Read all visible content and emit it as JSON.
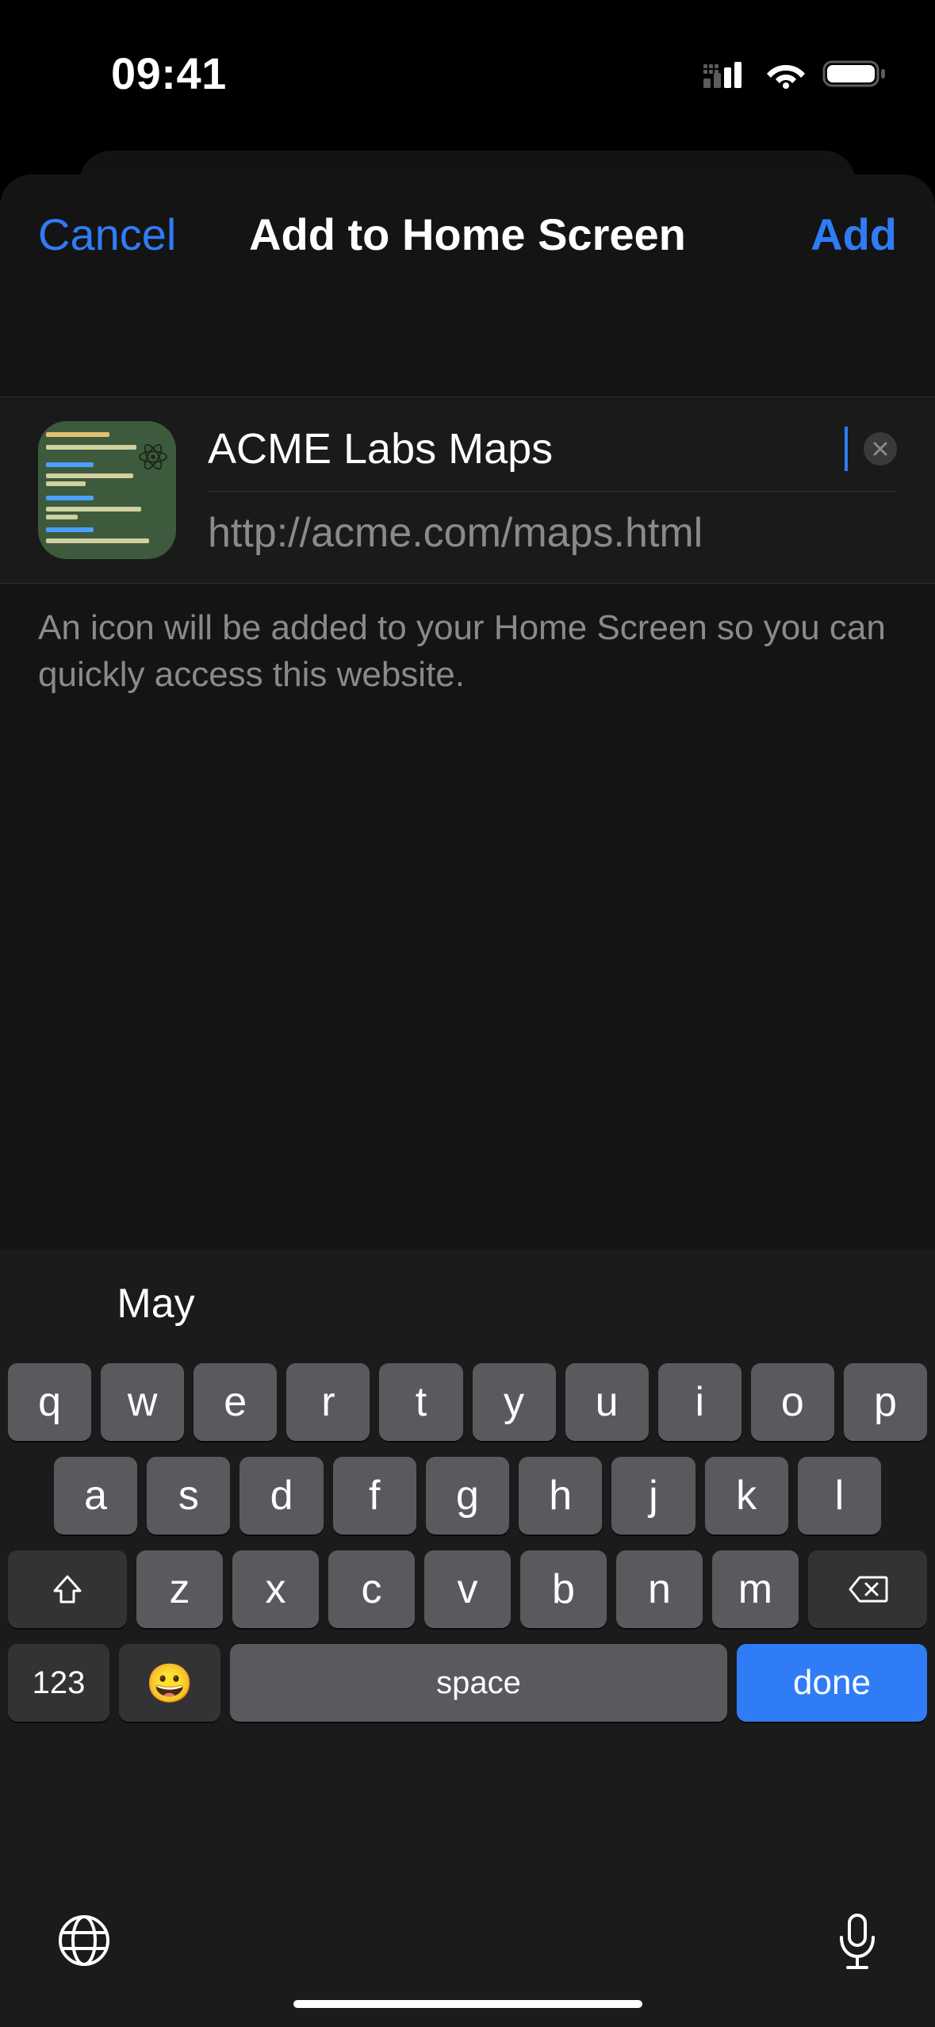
{
  "status": {
    "time": "09:41"
  },
  "nav": {
    "cancel": "Cancel",
    "title": "Add to Home Screen",
    "add": "Add"
  },
  "form": {
    "name_value": "ACME Labs Maps",
    "url": "http://acme.com/maps.html"
  },
  "hint": "An icon will be added to your Home Screen so you can quickly access this website.",
  "keyboard": {
    "suggestion": "May",
    "rows": {
      "r1": [
        "q",
        "w",
        "e",
        "r",
        "t",
        "y",
        "u",
        "i",
        "o",
        "p"
      ],
      "r2": [
        "a",
        "s",
        "d",
        "f",
        "g",
        "h",
        "j",
        "k",
        "l"
      ],
      "r3": [
        "z",
        "x",
        "c",
        "v",
        "b",
        "n",
        "m"
      ]
    },
    "num_key": "123",
    "space": "space",
    "done": "done"
  }
}
